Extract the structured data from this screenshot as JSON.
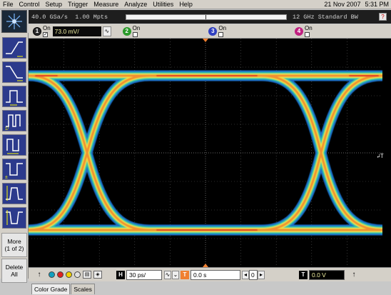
{
  "menu": {
    "items": [
      "File",
      "Control",
      "Setup",
      "Trigger",
      "Measure",
      "Analyze",
      "Utilities",
      "Help"
    ],
    "date": "21 Nov 2007",
    "time": "5:31 PM"
  },
  "status": {
    "sample_rate": "40.0 GSa/s",
    "memory": "1.00 Mpts",
    "bandwidth": "12 GHz Standard BW",
    "help": "?"
  },
  "channels": [
    {
      "num": "1",
      "on_label": "On",
      "checked": "✓",
      "scale": "73.0 mV/",
      "coupling": "∿",
      "color": "#f0c000"
    },
    {
      "num": "2",
      "on_label": "On",
      "checked": "",
      "color": "#2a9a2a"
    },
    {
      "num": "3",
      "on_label": "On",
      "checked": "",
      "color": "#3040c0"
    },
    {
      "num": "4",
      "on_label": "On",
      "checked": "",
      "color": "#c02080"
    }
  ],
  "sidebar": {
    "more_label": "More",
    "more_page": "(1 of 2)",
    "delete_label": "Delete",
    "delete_sub": "All"
  },
  "bottom": {
    "horizontal_label": "H",
    "timebase": "30 ps/",
    "delay_label": "T",
    "delay": "0.0 s",
    "ref_value": "0",
    "trigger_label": "T",
    "trigger_level": "0.0 V",
    "color_dots": [
      "#10a0c0",
      "#e02020",
      "#f0d000",
      "#c0c0c0"
    ]
  },
  "tabs": [
    "Color Grade",
    "Scales"
  ],
  "icons": {
    "logo": "agilent-spark-icon",
    "tools": [
      "rising-edge-icon",
      "falling-edge-icon",
      "positive-pulse-icon",
      "pulse-width-icon",
      "period-icon",
      "negative-pulse-icon",
      "rise-time-icon",
      "fall-time-icon"
    ]
  }
}
